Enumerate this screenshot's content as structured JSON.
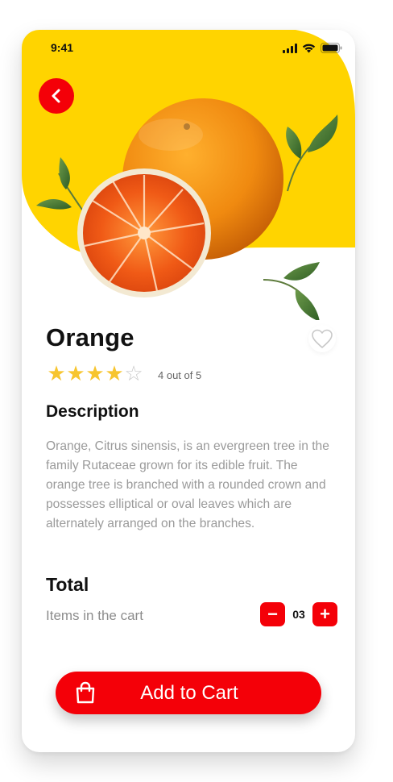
{
  "status_bar": {
    "time": "9:41"
  },
  "product": {
    "name": "Orange",
    "rating": 4,
    "rating_max": 5,
    "rating_text": "4 out of 5"
  },
  "description": {
    "title": "Description",
    "text": "Orange, Citrus sinensis, is an evergreen tree in the family Rutaceae grown for its edible fruit. The orange tree is branched with a rounded crown and possesses elliptical or oval leaves which are alternately arranged on the branches."
  },
  "total": {
    "title": "Total",
    "items_label": "Items in the cart",
    "quantity": "03",
    "decrement_symbol": "−",
    "increment_symbol": "+"
  },
  "cta": {
    "label": "Add to Cart"
  },
  "colors": {
    "accent": "#f40008",
    "hero_background": "#ffd400",
    "star": "#f7c52e",
    "muted_text": "#9a9a9a"
  },
  "icons": {
    "back": "chevron-left-icon",
    "favorite": "heart-icon",
    "cart": "shopping-bag-icon",
    "signal": "signal-icon",
    "wifi": "wifi-icon",
    "battery": "battery-icon"
  }
}
